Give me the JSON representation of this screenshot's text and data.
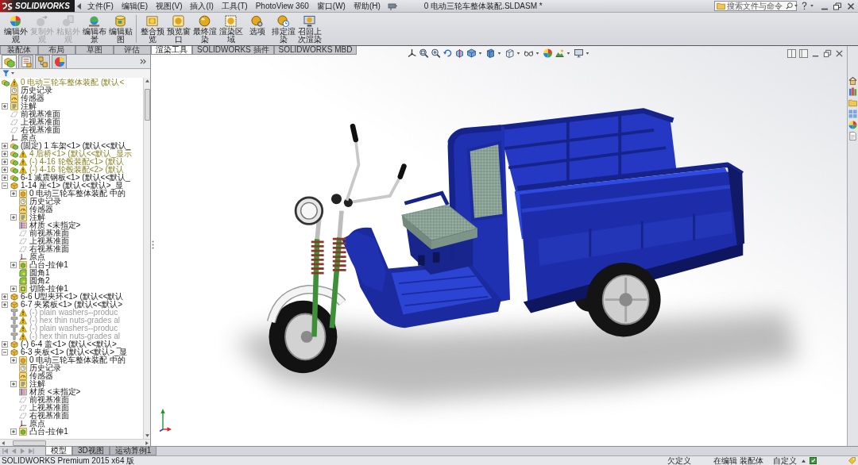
{
  "title_bar": {
    "app_name": "SOLIDWORKS",
    "menus": [
      "文件(F)",
      "编辑(E)",
      "视图(V)",
      "插入(I)",
      "工具(T)",
      "PhotoView 360",
      "窗口(W)",
      "帮助(H)"
    ],
    "document_title": "0 电动三轮车整体装配.SLDASM *",
    "search": {
      "placeholder": "搜索文件与命令"
    }
  },
  "ribbon": {
    "groups": [
      {
        "buttons": [
          {
            "label": "编辑外观",
            "disabled": false
          },
          {
            "label": "复制外观",
            "disabled": true
          },
          {
            "label": "粘贴外观",
            "disabled": true
          },
          {
            "label": "编辑布景",
            "disabled": false
          },
          {
            "label": "编辑贴图",
            "disabled": false
          }
        ]
      },
      {
        "buttons": [
          {
            "label": "整合预览",
            "disabled": false
          },
          {
            "label": "预览窗口",
            "disabled": false
          },
          {
            "label": "最终渲染",
            "disabled": false
          },
          {
            "label": "渲染区域",
            "disabled": false
          },
          {
            "label": "选项",
            "disabled": false
          },
          {
            "label": "排定渲染",
            "disabled": false
          },
          {
            "label": "召回上次渲染",
            "disabled": false
          }
        ]
      }
    ]
  },
  "command_tabs": [
    {
      "label": "装配体",
      "selected": false
    },
    {
      "label": "布局",
      "selected": false
    },
    {
      "label": "草图",
      "selected": false
    },
    {
      "label": "评估",
      "selected": false
    },
    {
      "label": "渲染工具",
      "selected": true
    },
    {
      "label": "SOLIDWORKS 插件",
      "selected": false
    },
    {
      "label": "SOLIDWORKS MBD",
      "selected": false
    }
  ],
  "feature_manager": {
    "panel_tabs": [
      {
        "selected": true
      },
      {
        "selected": false
      },
      {
        "selected": false
      },
      {
        "selected": false
      }
    ],
    "tree": [
      {
        "label": "0 电动三轮车整体装配 (默认<",
        "kind": "assembly",
        "warning": true,
        "suppressed": false,
        "children": [
          {
            "label": "历史记录",
            "kind": "history",
            "warning": false,
            "suppressed": false
          },
          {
            "label": "传感器",
            "kind": "sensor",
            "warning": false,
            "suppressed": false
          },
          {
            "label": "注解",
            "kind": "annotation",
            "warning": false,
            "suppressed": false,
            "expanded": false
          },
          {
            "label": "前视基准面",
            "kind": "plane",
            "warning": false,
            "suppressed": false
          },
          {
            "label": "上视基准面",
            "kind": "plane",
            "warning": false,
            "suppressed": false
          },
          {
            "label": "右视基准面",
            "kind": "plane",
            "warning": false,
            "suppressed": false
          },
          {
            "label": "原点",
            "kind": "origin",
            "warning": false,
            "suppressed": false
          },
          {
            "label": "(固定) 1 车架<1> (默认<<默认_",
            "kind": "assembly",
            "warning": false,
            "suppressed": false,
            "expanded": false
          },
          {
            "label": "4 后桥<1> (默认<<默认_显示",
            "kind": "assembly",
            "warning": true,
            "suppressed": false,
            "expanded": false
          },
          {
            "label": "(-) 4-16 轮毂装配<1> (默认",
            "kind": "assembly",
            "warning": true,
            "suppressed": false,
            "expanded": false
          },
          {
            "label": "(-) 4-16 轮毂装配<2> (默认",
            "kind": "assembly",
            "warning": true,
            "suppressed": false,
            "expanded": false
          },
          {
            "label": "6-1 减震钢板<1> (默认<<默认_",
            "kind": "assembly",
            "warning": false,
            "suppressed": false,
            "expanded": false
          },
          {
            "label": "1-14 座<1> (默认<<默认>_显",
            "kind": "part",
            "warning": false,
            "suppressed": false,
            "expanded": true,
            "children": [
              {
                "label": "0 电动三轮车整体装配 中的",
                "kind": "reference",
                "warning": false,
                "suppressed": false,
                "expanded": false
              },
              {
                "label": "历史记录",
                "kind": "history",
                "warning": false,
                "suppressed": false
              },
              {
                "label": "传感器",
                "kind": "sensor",
                "warning": false,
                "suppressed": false
              },
              {
                "label": "注解",
                "kind": "annotation",
                "warning": false,
                "suppressed": false,
                "expanded": false
              },
              {
                "label": "材质 <未指定>",
                "kind": "material",
                "warning": false,
                "suppressed": false
              },
              {
                "label": "前视基准面",
                "kind": "plane",
                "warning": false,
                "suppressed": false
              },
              {
                "label": "上视基准面",
                "kind": "plane",
                "warning": false,
                "suppressed": false
              },
              {
                "label": "右视基准面",
                "kind": "plane",
                "warning": false,
                "suppressed": false
              },
              {
                "label": "原点",
                "kind": "origin",
                "warning": false,
                "suppressed": false
              },
              {
                "label": "凸台-拉伸1",
                "kind": "boss",
                "warning": false,
                "suppressed": false,
                "expanded": false
              },
              {
                "label": "圆角1",
                "kind": "fillet",
                "warning": false,
                "suppressed": false
              },
              {
                "label": "圆角2",
                "kind": "fillet",
                "warning": false,
                "suppressed": false
              },
              {
                "label": "切除-拉伸1",
                "kind": "cut",
                "warning": false,
                "suppressed": false,
                "expanded": false
              }
            ]
          },
          {
            "label": "6-6 U型夹环<1> (默认<<默认",
            "kind": "part",
            "warning": false,
            "suppressed": false,
            "expanded": false
          },
          {
            "label": "6-7 夹紧板<1> (默认<<默认>",
            "kind": "part",
            "warning": false,
            "suppressed": false,
            "expanded": false
          },
          {
            "label": "(-) plain washers--produc",
            "kind": "toolbox",
            "warning": true,
            "suppressed": true
          },
          {
            "label": "(-) hex thin nuts-grades al",
            "kind": "toolbox",
            "warning": true,
            "suppressed": true
          },
          {
            "label": "(-) plain washers--produc",
            "kind": "toolbox",
            "warning": true,
            "suppressed": true
          },
          {
            "label": "(-) hex thin nuts-grades al",
            "kind": "toolbox",
            "warning": true,
            "suppressed": true
          },
          {
            "label": "(-) 6-4 盖<1> (默认<<默认>_",
            "kind": "part",
            "warning": false,
            "suppressed": false,
            "expanded": false
          },
          {
            "label": "6-3 夹板<1> (默认<<默认>_显",
            "kind": "part",
            "warning": false,
            "suppressed": false,
            "expanded": true,
            "children": [
              {
                "label": "0 电动三轮车整体装配 中的",
                "kind": "reference",
                "warning": false,
                "suppressed": false,
                "expanded": false
              },
              {
                "label": "历史记录",
                "kind": "history",
                "warning": false,
                "suppressed": false
              },
              {
                "label": "传感器",
                "kind": "sensor",
                "warning": false,
                "suppressed": false
              },
              {
                "label": "注解",
                "kind": "annotation",
                "warning": false,
                "suppressed": false,
                "expanded": false
              },
              {
                "label": "材质 <未指定>",
                "kind": "material",
                "warning": false,
                "suppressed": false
              },
              {
                "label": "前视基准面",
                "kind": "plane",
                "warning": false,
                "suppressed": false
              },
              {
                "label": "上视基准面",
                "kind": "plane",
                "warning": false,
                "suppressed": false
              },
              {
                "label": "右视基准面",
                "kind": "plane",
                "warning": false,
                "suppressed": false
              },
              {
                "label": "原点",
                "kind": "origin",
                "warning": false,
                "suppressed": false
              },
              {
                "label": "凸台-拉伸1",
                "kind": "boss",
                "warning": false,
                "suppressed": false,
                "expanded": false
              }
            ]
          }
        ]
      }
    ]
  },
  "bottom_tabs": [
    {
      "label": "模型",
      "selected": true
    },
    {
      "label": "3D视图",
      "selected": false
    },
    {
      "label": "运动算例1",
      "selected": false
    }
  ],
  "status_bar": {
    "edition": "SOLIDWORKS Premium 2015 x64 版",
    "definition": "欠定义",
    "editing": "在编辑 装配体",
    "units": "自定义"
  }
}
